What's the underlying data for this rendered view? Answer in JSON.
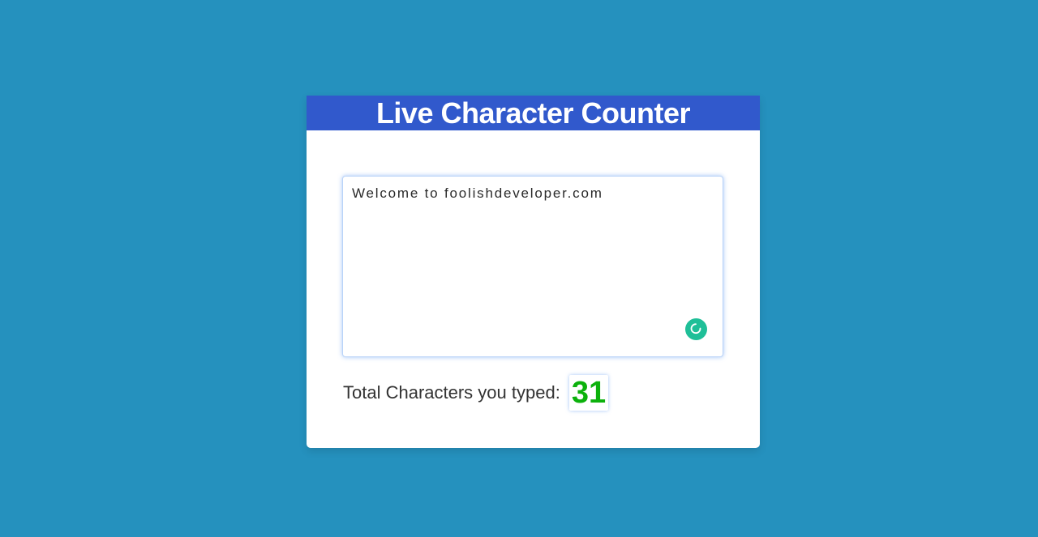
{
  "app": {
    "title": "Live Character Counter"
  },
  "editor": {
    "value": "Welcome to foolishdeveloper.com",
    "placeholder": "",
    "assistant_icon": "grammar-assistant-icon"
  },
  "counter": {
    "label": "Total Characters you typed:",
    "value": "31"
  },
  "colors": {
    "background": "#2591be",
    "header": "#3159cc",
    "count": "#0cb10c",
    "assistant_icon": "#1fbf98"
  }
}
